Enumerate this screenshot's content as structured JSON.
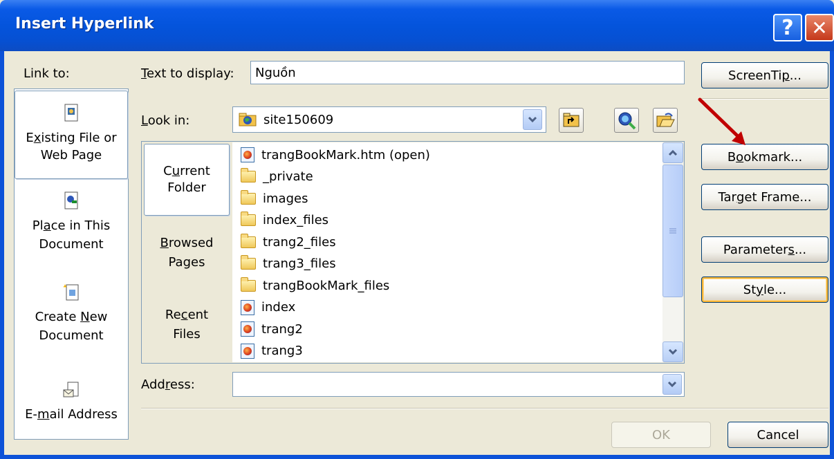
{
  "window": {
    "title": "Insert Hyperlink",
    "help_glyph": "?",
    "close_glyph": "✕"
  },
  "link_to": {
    "heading": "Link to:",
    "items": [
      {
        "line1_pre": "E",
        "line1_u": "x",
        "line1_post": "isting File or",
        "line2": "Web Page"
      },
      {
        "line1_pre": "Pl",
        "line1_u": "a",
        "line1_post": "ce in This",
        "line2": "Document"
      },
      {
        "line1_pre": "Create ",
        "line1_u": "N",
        "line1_post": "ew",
        "line2": "Document"
      },
      {
        "line1_pre": "E-",
        "line1_u": "m",
        "line1_post": "ail Address",
        "line2": ""
      }
    ]
  },
  "text_to_display": {
    "label_u": "T",
    "label_rest": "ext to display:",
    "value": "Nguồn"
  },
  "look_in": {
    "label_u": "L",
    "label_rest": "ook in:",
    "value": "site150609"
  },
  "view_tabs": [
    {
      "line1_pre": "C",
      "line1_u": "u",
      "line1_post": "rrent",
      "line2": "Folder"
    },
    {
      "line1_pre": "",
      "line1_u": "B",
      "line1_post": "rowsed",
      "line2": "Pages"
    },
    {
      "line1_pre": "Re",
      "line1_u": "c",
      "line1_post": "ent",
      "line2": "Files"
    }
  ],
  "files": [
    {
      "name": "trangBookMark.htm (open)",
      "icon": "htm-icon"
    },
    {
      "name": "_private",
      "icon": "folder-icon"
    },
    {
      "name": "images",
      "icon": "folder-icon"
    },
    {
      "name": "index_files",
      "icon": "folder-icon"
    },
    {
      "name": "trang2_files",
      "icon": "folder-icon"
    },
    {
      "name": "trang3_files",
      "icon": "folder-icon"
    },
    {
      "name": "trangBookMark_files",
      "icon": "folder-icon"
    },
    {
      "name": "index",
      "icon": "htm-icon"
    },
    {
      "name": "trang2",
      "icon": "htm-icon"
    },
    {
      "name": "trang3",
      "icon": "htm-icon"
    }
  ],
  "address": {
    "label_pre": "Add",
    "label_u": "r",
    "label_post": "ess:",
    "value": ""
  },
  "buttons": {
    "screentip": {
      "pre": "ScreenTi",
      "u": "p",
      "post": "..."
    },
    "bookmark": {
      "pre": "B",
      "u": "o",
      "post": "okmark..."
    },
    "target_frame": {
      "pre": "Tar",
      "u": "g",
      "post": "et Frame..."
    },
    "parameters": {
      "pre": "Parameter",
      "u": "s",
      "post": "..."
    },
    "style": {
      "pre": "St",
      "u": "y",
      "post": "le..."
    },
    "ok": "OK",
    "cancel": "Cancel"
  },
  "colors": {
    "title_bar": "#0454DC",
    "dialog_bg": "#ECE9D8",
    "arrow": "#C00000",
    "focus": "#F8B636"
  }
}
